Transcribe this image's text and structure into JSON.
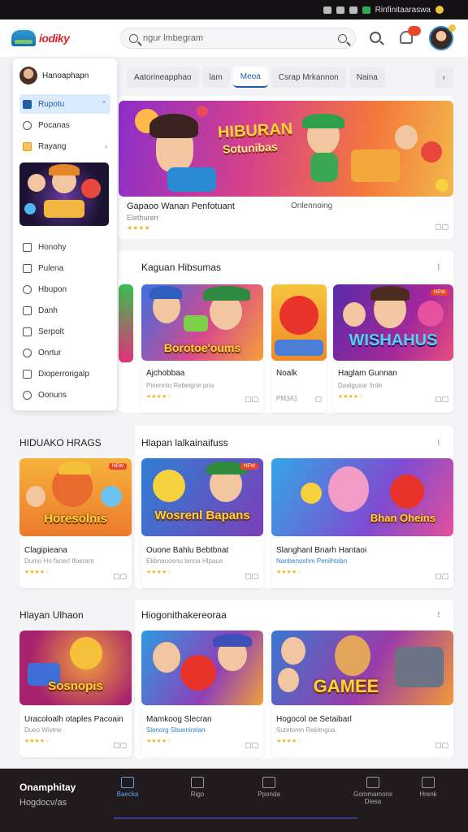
{
  "status_bar": {
    "text": "Rinfinitaaraswa"
  },
  "header": {
    "logo": "iodiky",
    "search_placeholder": "ngur lmbegram"
  },
  "drawer": {
    "user": "Hanoaphapn",
    "items": [
      {
        "label": "Rupotu",
        "active": true
      },
      {
        "label": "Pocanas"
      },
      {
        "label": "Rayang"
      }
    ],
    "items2": [
      {
        "label": "Honohy"
      },
      {
        "label": "Pulena"
      },
      {
        "label": "Hbupon"
      },
      {
        "label": "Danh"
      },
      {
        "label": "Serpolt"
      },
      {
        "label": "Onrtur"
      },
      {
        "label": "Dioperrorigalp"
      },
      {
        "label": "Oonuns"
      }
    ]
  },
  "chips": [
    "Aatorineapphao",
    "lam",
    "Meoa",
    "Csrap Mrkannon",
    "Naina"
  ],
  "hero": {
    "title": "HIBURAN",
    "subtitle": "Sotunibas",
    "caption": "Gapaoo Wanan Penfotuant",
    "meta": "Elethurerr",
    "right": "Onlennoing"
  },
  "section1": {
    "title": "Kaguan Hibsumas",
    "cards": [
      {
        "art": "Borotoe'oums",
        "title": "Ajchobbaa",
        "meta": "Pinennlo Rebelgrie pna",
        "stars": "★★★★☆"
      },
      {
        "title": "Noalk",
        "meta": "PM3A1"
      },
      {
        "art": "WISHAHUS",
        "title": "Haglam Gunnan",
        "meta": "Daalgusar Ilrde",
        "stars": "★★★★☆"
      }
    ]
  },
  "section2": {
    "left_title": "HIDUAKO HRAGS",
    "title": "Hlapan lalkainaifuss",
    "cards": [
      {
        "art": "Horesolnis",
        "title": "Clagipieana",
        "meta": "Dumo Ho fanerl Ifoerant",
        "stars": "★★★★☆"
      },
      {
        "art": "Wosrenl Bapans",
        "title": "Ouone Bahlu Bebtbnat",
        "meta": "Ekbnaooenu lanoa Hlpaue",
        "stars": "★★★★☆"
      },
      {
        "art": "Bhan Oheins",
        "title": "Slanghanl Bnarh Hantaoi",
        "meta": "Nanbenoshm Penilhtsbn",
        "stars": "★★★★☆"
      }
    ]
  },
  "section3": {
    "left_title": "Hlayan Ulhaon",
    "title": "Hiogonithakereoraa",
    "cards": [
      {
        "art": "Sosnopis",
        "title": "Uracoloalh otaples Pacoain",
        "meta": "Dueo Wivtne",
        "stars": "★★★★☆"
      },
      {
        "title": "Mamkoog Slecran",
        "meta": "Slenorg Sbuenirelan",
        "stars": "★★★★☆"
      },
      {
        "art": "GAMEE",
        "title": "Hogocol oe Setaibarl",
        "meta": "Sutetomn Rekitngua",
        "stars": "★★★★☆"
      }
    ]
  },
  "bottom": {
    "brand": "Onamphitay",
    "brand2": "Hogdocv/as",
    "nav": [
      {
        "label": "Baecka",
        "active": true
      },
      {
        "label": "Rigo"
      },
      {
        "label": "Pponda"
      },
      {
        "label": "Gommamons Diesa"
      },
      {
        "label": "Hrenk"
      }
    ]
  },
  "colors": {
    "accent": "#1c5ea8",
    "brand_red": "#d8262f",
    "bottom_bar": "#221b1e"
  }
}
